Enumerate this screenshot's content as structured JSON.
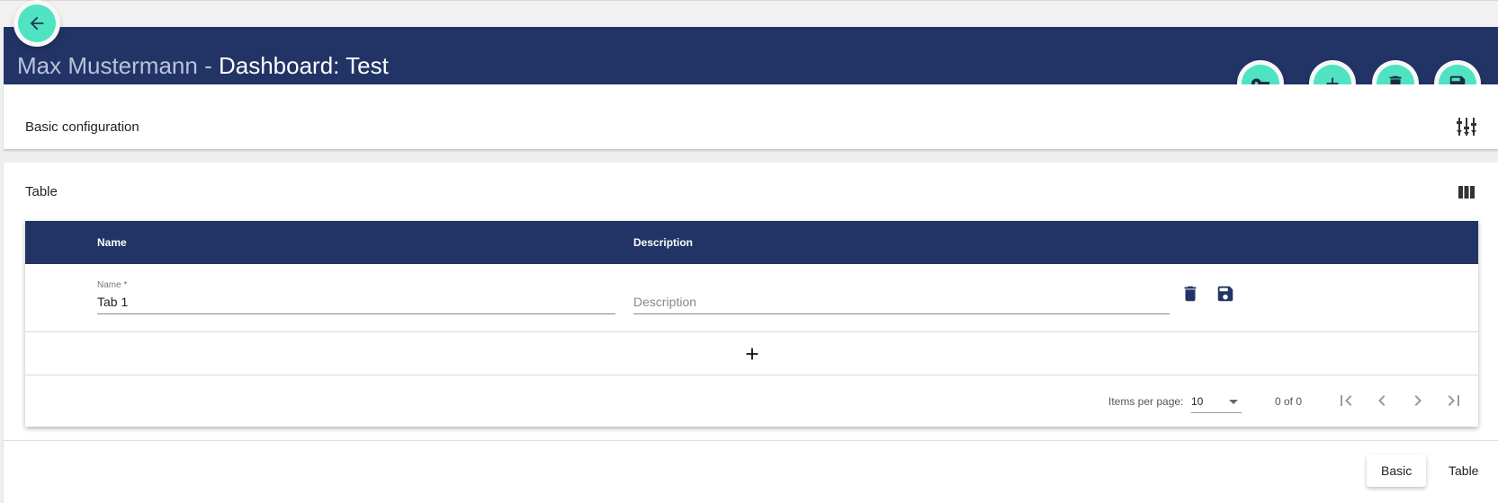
{
  "header": {
    "user_name": "Max Mustermann",
    "separator": " - ",
    "dashboard_title": "Dashboard: Test"
  },
  "icons": {
    "back": "arrow-left-icon",
    "permissions": "key-icon",
    "add": "plus-icon",
    "delete": "trash-icon",
    "save": "floppy-disk-icon",
    "basic_config": "sliders-icon",
    "table_columns": "columns-icon"
  },
  "colors": {
    "header_bg": "#223366",
    "fab_accent": "#4fe3c1"
  },
  "sections": {
    "basic": {
      "label": "Basic configuration"
    },
    "table": {
      "label": "Table"
    }
  },
  "table": {
    "columns": [
      "Name",
      "Description"
    ],
    "rows": [
      {
        "name_label": "Name *",
        "name_value": "Tab 1",
        "description_placeholder": "Description",
        "description_value": ""
      }
    ]
  },
  "paginator": {
    "items_per_page_label": "Items per page:",
    "page_size": "10",
    "range_label": "0 of 0"
  },
  "bottom_tabs": [
    {
      "label": "Basic",
      "active": true
    },
    {
      "label": "Table",
      "active": false
    }
  ]
}
